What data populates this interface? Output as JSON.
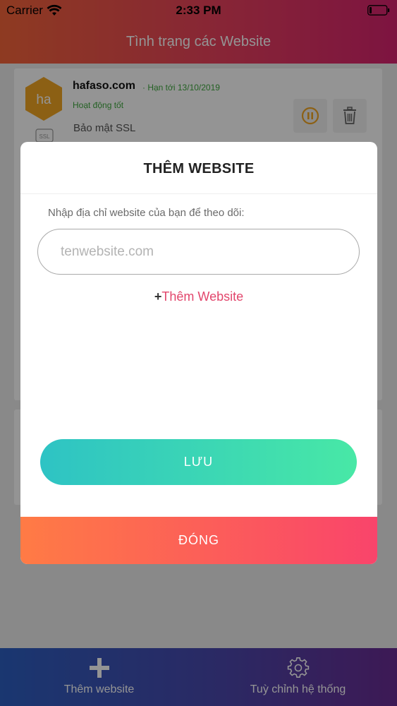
{
  "status_bar": {
    "carrier": "Carrier",
    "time": "2:33 PM"
  },
  "header": {
    "title": "Tình trạng các Website"
  },
  "site": {
    "logo_text": "ha",
    "domain": "hafaso.com",
    "expiry": "· Hạn tới 13/10/2019",
    "status": "Hoạt động tốt",
    "ssl_badge": "SSL",
    "ssl_label": "Bảo mật SSL"
  },
  "tabbar": {
    "add_label": "Thêm website",
    "settings_label": "Tuỳ chỉnh hệ thống"
  },
  "modal": {
    "title": "THÊM WEBSITE",
    "instruction": "Nhập địa chỉ website của bạn để theo dõi:",
    "input_value": "",
    "input_placeholder": "tenwebsite.com",
    "add_plus": "+",
    "add_link": "Thêm Website",
    "save_label": "LƯU",
    "close_label": "ĐÓNG"
  },
  "colors": {
    "header_start": "#f5653a",
    "header_end": "#d8236f",
    "save_start": "#2ec3c4",
    "save_end": "#48e8a6",
    "close_start": "#ff7b45",
    "close_end": "#f9446b",
    "link": "#e2466c",
    "status_ok": "#3ea83e",
    "logo_orange": "#f2a623"
  }
}
